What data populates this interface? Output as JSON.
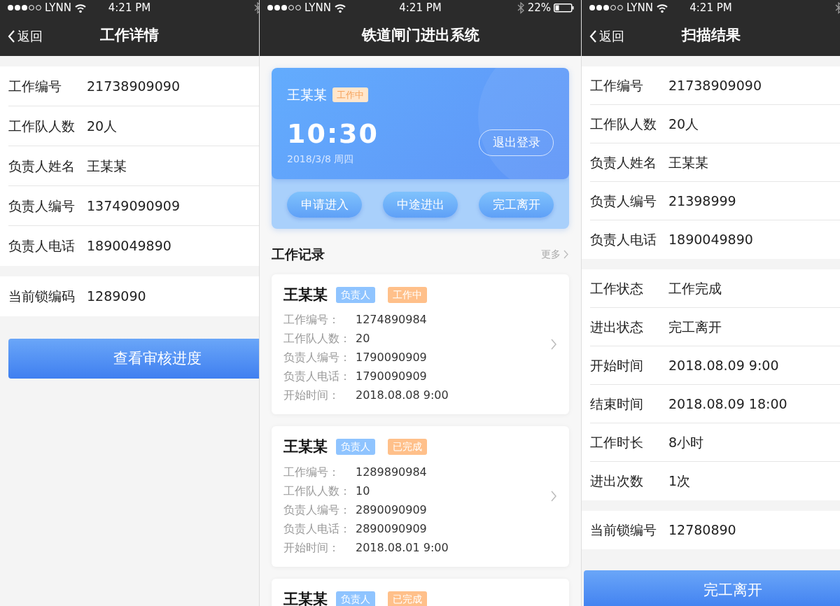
{
  "screens": [
    {
      "kind": "detail",
      "status_bar": {
        "carrier": "LYNN",
        "time": "4:21 PM"
      },
      "nav": {
        "back": "返回",
        "title": "工作详情"
      },
      "groups": [
        [
          {
            "label": "工作编号",
            "value": "21738909090"
          },
          {
            "label": "工作队人数",
            "value": "20人"
          },
          {
            "label": "负责人姓名",
            "value": "王某某"
          },
          {
            "label": "负责人编号",
            "value": "13749090909"
          },
          {
            "label": "负责人电话",
            "value": "1890049890"
          }
        ],
        [
          {
            "label": "当前锁编码",
            "value": "1289090"
          }
        ]
      ],
      "button": "查看审核进度"
    },
    {
      "kind": "home",
      "status_bar": {
        "carrier": "LYNN",
        "time": "4:21 PM",
        "battery": "22%"
      },
      "nav": {
        "title": "铁道闸门进出系统"
      },
      "hero": {
        "name": "王某某",
        "status": "工作中",
        "time": "10:30",
        "date": "2018/3/8 周四",
        "logout": "退出登录",
        "actions": [
          "申请进入",
          "中途进出",
          "完工离开"
        ]
      },
      "records_title": "工作记录",
      "more": "更多",
      "records": [
        {
          "name": "王某某",
          "role": "负责人",
          "status": "工作中",
          "fields": [
            {
              "label": "工作编号：",
              "value": "1274890984"
            },
            {
              "label": "工作队人数：",
              "value": "20"
            },
            {
              "label": "负责人编号：",
              "value": "1790090909"
            },
            {
              "label": "负责人电话：",
              "value": "1790090909"
            },
            {
              "label": "开始时间：",
              "value": "2018.08.08 9:00"
            }
          ]
        },
        {
          "name": "王某某",
          "role": "负责人",
          "status": "已完成",
          "fields": [
            {
              "label": "工作编号：",
              "value": "1289890984"
            },
            {
              "label": "工作队人数：",
              "value": "10"
            },
            {
              "label": "负责人编号：",
              "value": "2890090909"
            },
            {
              "label": "负责人电话：",
              "value": "2890090909"
            },
            {
              "label": "开始时间：",
              "value": "2018.08.01 9:00"
            }
          ]
        },
        {
          "name": "王某某",
          "role": "负责人",
          "status": "已完成"
        }
      ]
    },
    {
      "kind": "detail",
      "status_bar": {
        "carrier": "LYNN",
        "time": "4:21 PM"
      },
      "nav": {
        "back": "返回",
        "title": "扫描结果"
      },
      "groups": [
        [
          {
            "label": "工作编号",
            "value": "21738909090"
          },
          {
            "label": "工作队人数",
            "value": "20人"
          },
          {
            "label": "负责人姓名",
            "value": "王某某"
          },
          {
            "label": "负责人编号",
            "value": "21398999"
          },
          {
            "label": "负责人电话",
            "value": "1890049890"
          }
        ],
        [
          {
            "label": "工作状态",
            "value": "工作完成"
          },
          {
            "label": "进出状态",
            "value": "完工离开"
          },
          {
            "label": "开始时间",
            "value": "2018.08.09 9:00"
          },
          {
            "label": "结束时间",
            "value": "2018.08.09 18:00"
          },
          {
            "label": "工作时长",
            "value": "8小时"
          },
          {
            "label": "进出次数",
            "value": "1次"
          }
        ],
        [
          {
            "label": "当前锁编号",
            "value": "12780890"
          }
        ]
      ],
      "button": "完工离开"
    }
  ]
}
